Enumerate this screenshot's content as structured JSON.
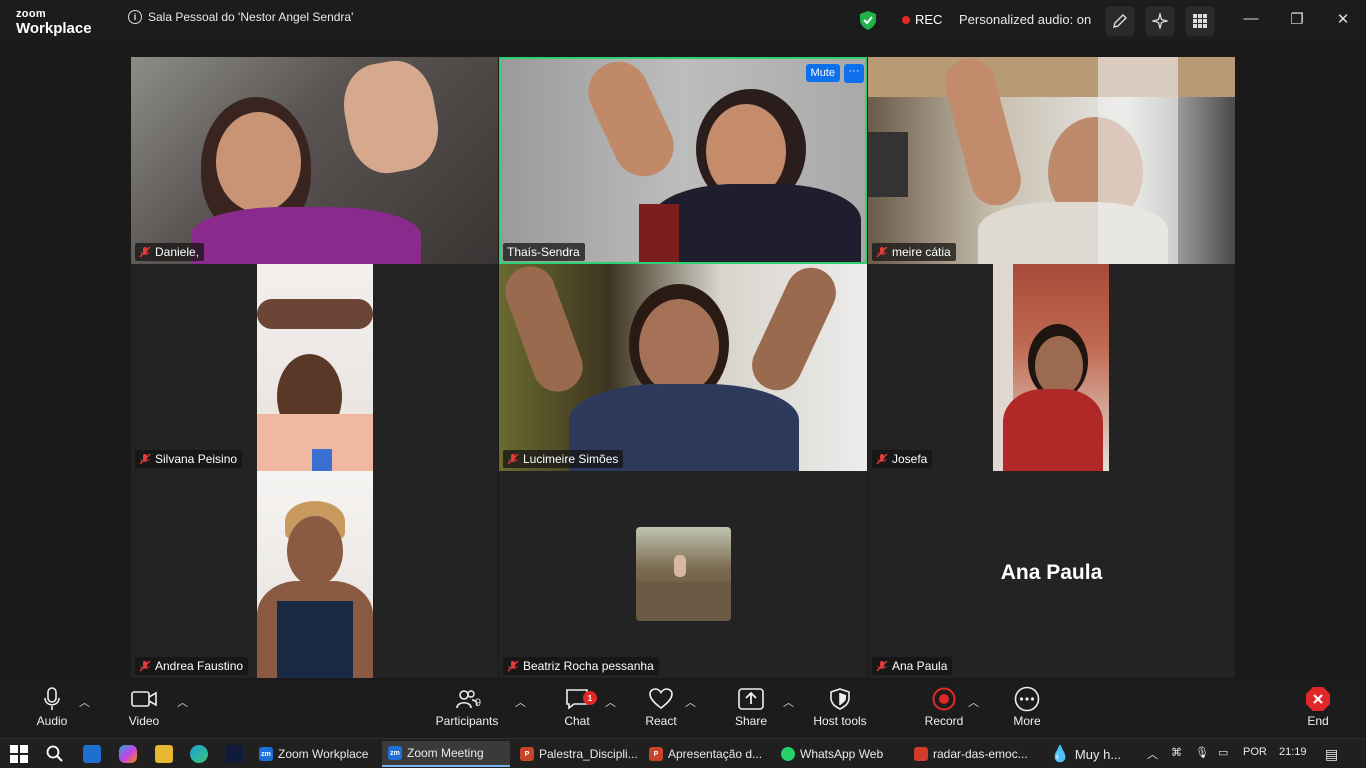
{
  "app": {
    "brand_small": "zoom",
    "brand_large": "Workplace"
  },
  "titlebar": {
    "meeting_info": "Sala Pessoal do 'Nestor Angel Sendra'",
    "rec_label": "REC",
    "audio_status": "Personalized audio: on"
  },
  "participants": [
    {
      "name": "Daniele,",
      "muted": true
    },
    {
      "name": "Thaís-Sendra",
      "muted": false,
      "active_speaker": true,
      "mute_label": "Mute",
      "more_label": "···"
    },
    {
      "name": "meire cátia",
      "muted": true
    },
    {
      "name": "Silvana Peisino",
      "muted": true
    },
    {
      "name": "Lucimeire Simões",
      "muted": true
    },
    {
      "name": "Josefa",
      "muted": true
    },
    {
      "name": "Andrea Faustino",
      "muted": true
    },
    {
      "name": "Beatriz Rocha pessanha",
      "muted": true
    },
    {
      "name": "Ana Paula",
      "muted": true,
      "display_name": "Ana Paula"
    }
  ],
  "toolbar": {
    "audio": "Audio",
    "video": "Video",
    "participants": "Participants",
    "participants_count": "9",
    "chat": "Chat",
    "chat_badge": "1",
    "react": "React",
    "share": "Share",
    "host_tools": "Host tools",
    "record": "Record",
    "more": "More",
    "end": "End"
  },
  "taskbar": {
    "apps": [
      {
        "label": "Zoom Workplace",
        "active": false
      },
      {
        "label": "Zoom Meeting",
        "active": true
      },
      {
        "label": "Palestra_Discipli...",
        "active": false
      },
      {
        "label": "Apresentação d...",
        "active": false
      },
      {
        "label": "WhatsApp Web",
        "active": false
      },
      {
        "label": "radar-das-emoc...",
        "active": false
      },
      {
        "label": "Muy h...",
        "active": false
      }
    ],
    "language": "POR",
    "time": "21:19"
  },
  "colors": {
    "active_border": "#2fd072",
    "accent_blue": "#0e71eb",
    "record_red": "#e02828",
    "end_red": "#e02828",
    "shield_green": "#21b14b"
  }
}
